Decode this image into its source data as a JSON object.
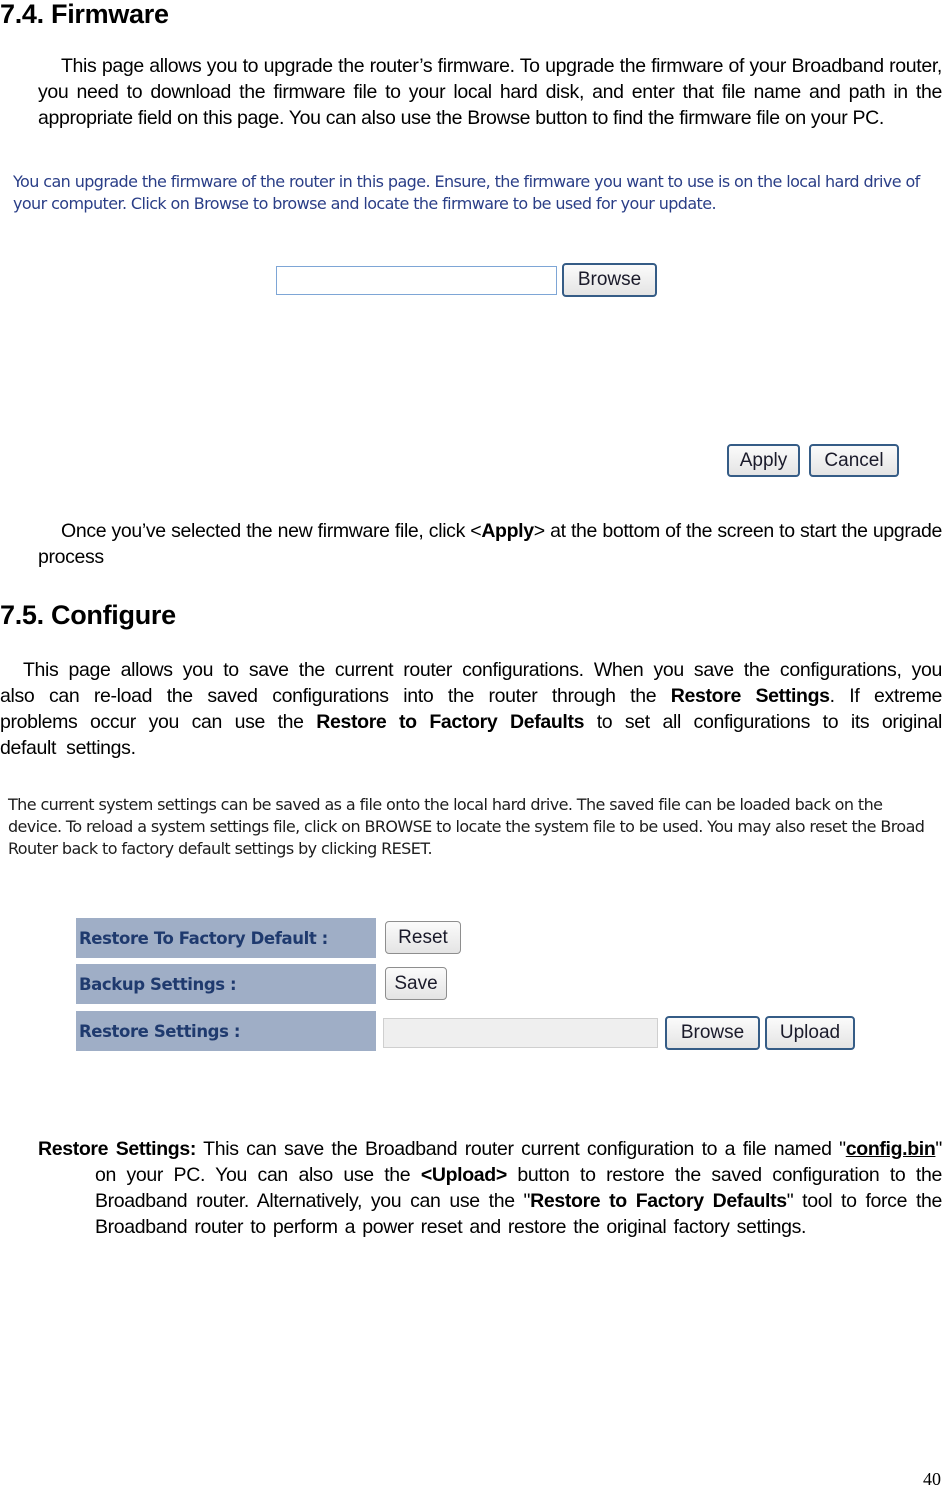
{
  "section_firmware": {
    "heading": "7.4. Firmware",
    "intro": "This page allows you to upgrade the router’s firmware. To upgrade the firmware of your Broadband router, you need to download the firmware file to your local hard disk, and enter that file name and path in the appropriate field on this page. You can also use the Browse button to find the firmware file on your PC.",
    "screenshot": {
      "description": "You can upgrade the firmware of the router in this page. Ensure, the firmware you want to use is on the local hard drive of your computer. Click on Browse to browse and locate the firmware to be used for your update.",
      "file_input_value": "",
      "browse_label": "Browse",
      "apply_label": "Apply",
      "cancel_label": "Cancel"
    },
    "after_text_1": "Once you’ve selected the new firmware file, click <",
    "after_text_bold": "Apply",
    "after_text_2": "> at the bottom of the screen to start the upgrade process"
  },
  "section_configure": {
    "heading": "7.5. Configure",
    "intro_1": "This page allows you to save the current router configurations. When you save the configurations, you also can re-load the saved configurations into the router through the ",
    "intro_bold_1": "Restore Settings",
    "intro_2": ". If extreme problems occur you can use the ",
    "intro_bold_2": "Restore to Factory Defaults",
    "intro_3": " to set all configurations to its original default settings.",
    "screenshot": {
      "description": "The current system settings can be saved as a file onto the local hard drive. The saved file can be loaded back on the device. To reload a system settings file, click on BROWSE to locate the system file to be used. You may also reset the Broad Router back to factory default settings by clicking RESET.",
      "rows": [
        {
          "label": "Restore To Factory Default :",
          "button": "Reset"
        },
        {
          "label": "Backup Settings :",
          "button": "Save"
        },
        {
          "label": "Restore Settings :",
          "file_input_value": "",
          "browse": "Browse",
          "upload": "Upload"
        }
      ]
    },
    "note": {
      "term": "Restore Settings:",
      "t1": " This can save the Broadband router current configuration to a file named \"",
      "filename": "config.bin",
      "t2": "\" on your PC. You can also use the ",
      "upload": "<Upload>",
      "t3": " button to restore the saved configuration to the Broadband router. Alternatively, you can use the \"",
      "factory": "Restore to Factory Defaults",
      "t4": "\" tool to force the Broadband router to perform a power reset and restore the original factory settings."
    }
  },
  "page_number": "40"
}
